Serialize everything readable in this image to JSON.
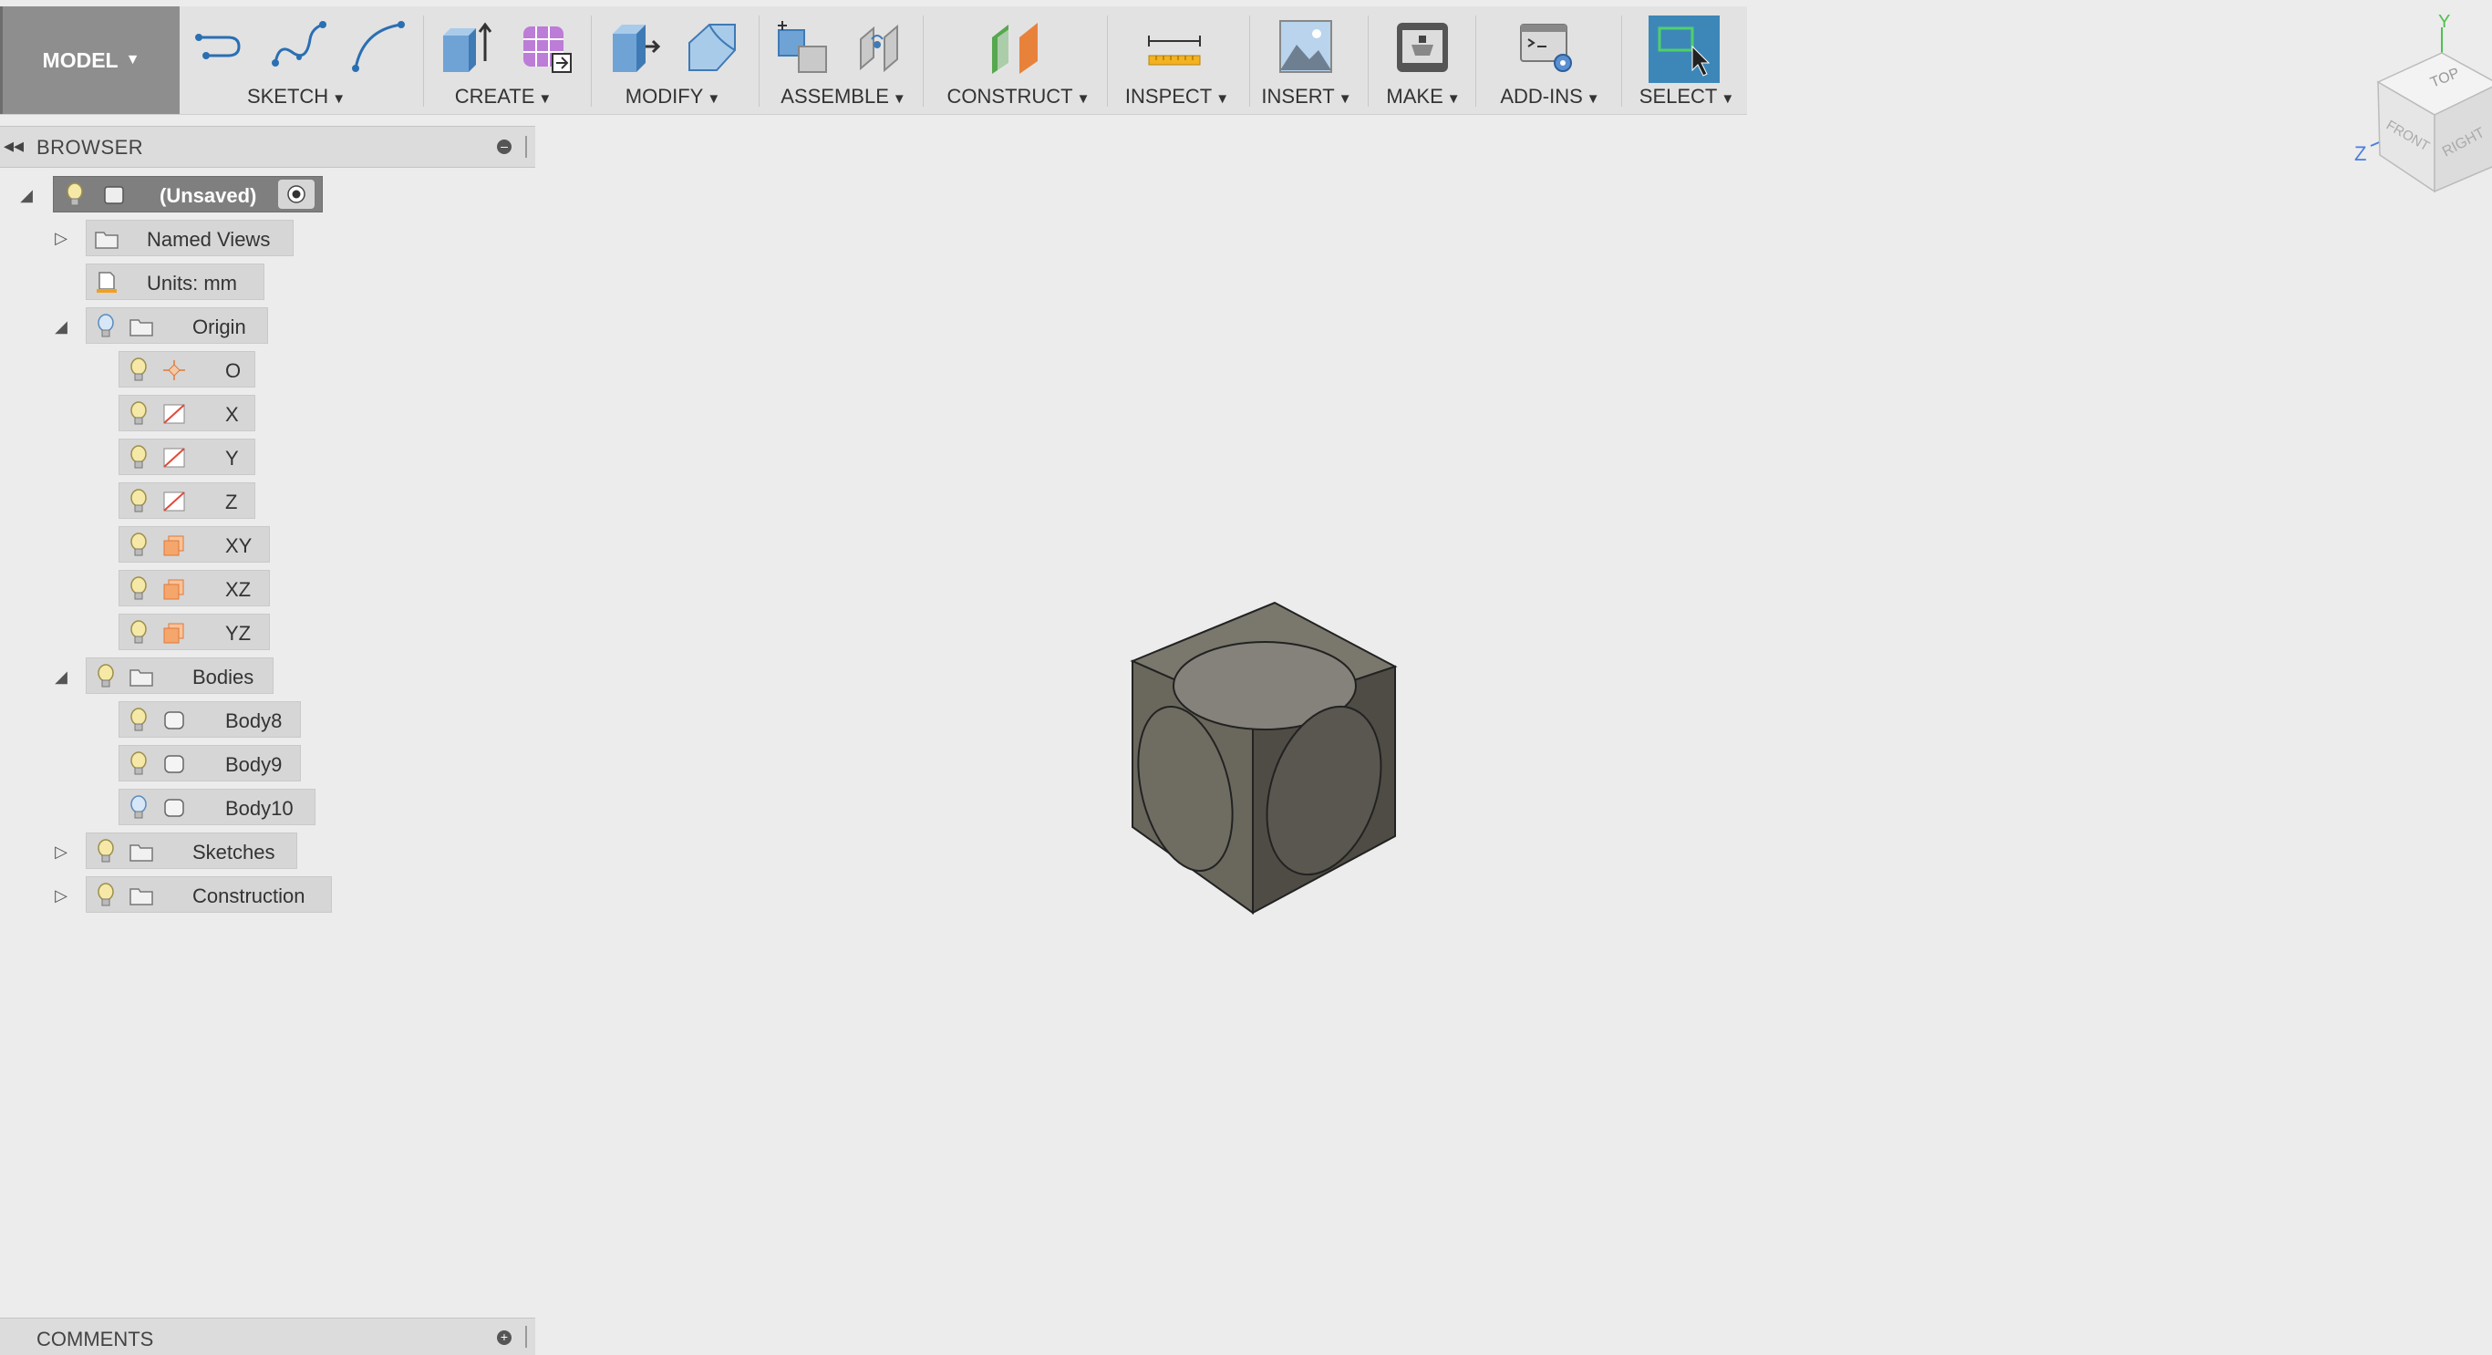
{
  "toolbar": {
    "workspace": "MODEL",
    "groups": {
      "sketch": "SKETCH",
      "create": "CREATE",
      "modify": "MODIFY",
      "assemble": "ASSEMBLE",
      "construct": "CONSTRUCT",
      "inspect": "INSPECT",
      "insert": "INSERT",
      "make": "MAKE",
      "addins": "ADD-INS",
      "select": "SELECT"
    },
    "icons": [
      "line-icon",
      "spline-icon",
      "arc-icon",
      "extrude-icon",
      "form-icon",
      "press-pull-icon",
      "fillet-icon",
      "new-component-icon",
      "joint-icon",
      "offset-plane-icon",
      "measure-icon",
      "insert-image-icon",
      "3d-print-icon",
      "scripts-icon",
      "select-window-icon"
    ]
  },
  "browser": {
    "title": "BROWSER",
    "root": "(Unsaved)",
    "named_views": "Named Views",
    "units": "Units: mm",
    "origin": {
      "label": "Origin",
      "items": [
        "O",
        "X",
        "Y",
        "Z",
        "XY",
        "XZ",
        "YZ"
      ]
    },
    "bodies": {
      "label": "Bodies",
      "items": [
        "Body8",
        "Body9",
        "Body10"
      ]
    },
    "sketches": "Sketches",
    "construction": "Construction"
  },
  "viewcube": {
    "top": "TOP",
    "front": "FRONT",
    "right": "RIGHT",
    "axis_y": "Y",
    "axis_z": "Z"
  },
  "comments": {
    "title": "COMMENTS"
  },
  "colors": {
    "toolbar_bg": "#e2e2e2",
    "workspace_bg": "#8e8e8e",
    "select_active": "#3c87b8",
    "model_face_top": "#7a786c",
    "model_face_left": "#6a685d",
    "model_face_right": "#4f4c45"
  }
}
